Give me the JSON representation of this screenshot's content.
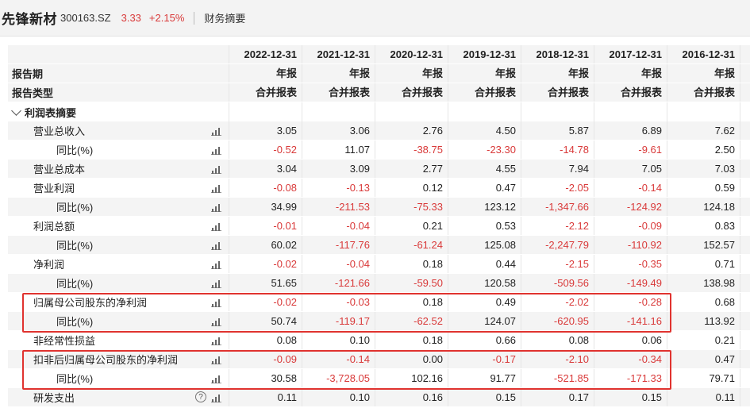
{
  "header": {
    "stock_name": "先锋新材",
    "stock_code": "300163.SZ",
    "price": "3.33",
    "change": "+2.15%",
    "section": "财务摘要"
  },
  "columns": {
    "period_label": "报告期",
    "type_label": "报告类型",
    "dates": [
      "2022-12-31",
      "2021-12-31",
      "2020-12-31",
      "2019-12-31",
      "2018-12-31",
      "2017-12-31",
      "2016-12-31"
    ],
    "period": [
      "年报",
      "年报",
      "年报",
      "年报",
      "年报",
      "年报",
      "年报"
    ],
    "type": [
      "合并报表",
      "合并报表",
      "合并报表",
      "合并报表",
      "合并报表",
      "合并报表",
      "合并报表"
    ]
  },
  "section": {
    "title": "利润表摘要"
  },
  "rows": [
    {
      "label": "营业总收入",
      "level": 1,
      "values": [
        "3.05",
        "3.06",
        "2.76",
        "4.50",
        "5.87",
        "6.89",
        "7.62"
      ]
    },
    {
      "label": "同比(%)",
      "level": 2,
      "values": [
        "-0.52",
        "11.07",
        "-38.75",
        "-23.30",
        "-14.78",
        "-9.61",
        "2.50"
      ]
    },
    {
      "label": "营业总成本",
      "level": 1,
      "values": [
        "3.04",
        "3.09",
        "2.77",
        "4.55",
        "7.94",
        "7.05",
        "7.03"
      ]
    },
    {
      "label": "营业利润",
      "level": 1,
      "values": [
        "-0.08",
        "-0.13",
        "0.12",
        "0.47",
        "-2.05",
        "-0.14",
        "0.59"
      ]
    },
    {
      "label": "同比(%)",
      "level": 2,
      "values": [
        "34.99",
        "-211.53",
        "-75.33",
        "123.12",
        "-1,347.66",
        "-124.92",
        "124.18"
      ]
    },
    {
      "label": "利润总额",
      "level": 1,
      "values": [
        "-0.01",
        "-0.04",
        "0.21",
        "0.53",
        "-2.12",
        "-0.09",
        "0.83"
      ]
    },
    {
      "label": "同比(%)",
      "level": 2,
      "values": [
        "60.02",
        "-117.76",
        "-61.24",
        "125.08",
        "-2,247.79",
        "-110.92",
        "152.57"
      ]
    },
    {
      "label": "净利润",
      "level": 1,
      "values": [
        "-0.02",
        "-0.04",
        "0.18",
        "0.44",
        "-2.15",
        "-0.35",
        "0.71"
      ]
    },
    {
      "label": "同比(%)",
      "level": 2,
      "values": [
        "51.65",
        "-121.66",
        "-59.50",
        "120.58",
        "-509.56",
        "-149.49",
        "138.98"
      ]
    },
    {
      "label": "归属母公司股东的净利润",
      "level": 1,
      "values": [
        "-0.02",
        "-0.03",
        "0.18",
        "0.49",
        "-2.02",
        "-0.28",
        "0.68"
      ]
    },
    {
      "label": "同比(%)",
      "level": 2,
      "values": [
        "50.74",
        "-119.17",
        "-62.52",
        "124.07",
        "-620.95",
        "-141.16",
        "113.92"
      ]
    },
    {
      "label": "非经常性损益",
      "level": 1,
      "values": [
        "0.08",
        "0.10",
        "0.18",
        "0.66",
        "0.08",
        "0.06",
        "0.21"
      ]
    },
    {
      "label": "扣非后归属母公司股东的净利润",
      "level": 1,
      "values": [
        "-0.09",
        "-0.14",
        "0.00",
        "-0.17",
        "-2.10",
        "-0.34",
        "0.47"
      ]
    },
    {
      "label": "同比(%)",
      "level": 2,
      "values": [
        "30.58",
        "-3,728.05",
        "102.16",
        "91.77",
        "-521.85",
        "-171.33",
        "79.71"
      ]
    },
    {
      "label": "研发支出",
      "level": 1,
      "help": true,
      "values": [
        "0.11",
        "0.10",
        "0.16",
        "0.15",
        "0.17",
        "0.15",
        "0.11"
      ]
    }
  ],
  "icons": {
    "chart": "bar-chart-icon",
    "help": "help-icon",
    "collapse": "chevron-down-icon"
  },
  "help_glyph": "?",
  "colors": {
    "negative": "#d93a3a",
    "highlight": "#e0332f",
    "zebra": "#f4f4f4"
  }
}
